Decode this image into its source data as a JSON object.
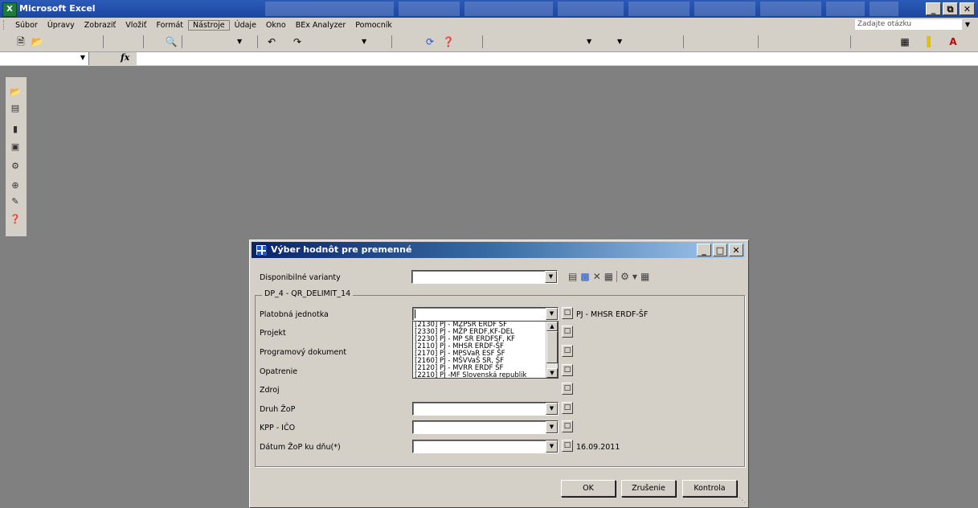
{
  "window": {
    "title": "Microsoft Excel"
  },
  "menu": {
    "items": [
      "Súbor",
      "Úpravy",
      "Zobraziť",
      "Vložiť",
      "Formát",
      "Nástroje",
      "Údaje",
      "Okno",
      "BEx Analyzer",
      "Pomocník"
    ],
    "help_placeholder": "Zadajte otázku"
  },
  "formula": {
    "fx": "fx"
  },
  "dialog": {
    "title": "Výber hodnôt pre premenné",
    "variants_label": "Disponibilné varianty",
    "group_title": "DP_4 - QR_DELIMIT_14",
    "fields": [
      {
        "label": "Platobná jednotka",
        "value": "PJ - MHSR  ERDF-ŠF"
      },
      {
        "label": "Projekt",
        "value": ""
      },
      {
        "label": "Programový dokument",
        "value": ""
      },
      {
        "label": "Opatrenie",
        "value": ""
      },
      {
        "label": "Zdroj",
        "value": ""
      },
      {
        "label": "Druh ŽoP",
        "value": ""
      },
      {
        "label": "KPP - IČO",
        "value": ""
      },
      {
        "label": "Dátum ŽoP ku dňu(*)",
        "value": "16.09.2011"
      }
    ],
    "dropdown_options": [
      "[2130] PJ - MŽPSR  ERDF ŠF",
      "[2330] PJ - MŽP  ERDF,KF-DEL",
      "[2230] PJ - MP SR ERDFSF, KF",
      "[2110] PJ  - MHSR  ERDF-ŠF",
      "[2170] PJ - MPSVaR ESF ŠF",
      "[2160] PJ - MŠVVaŠ SR, ŠF",
      "[2120] PJ - MVRR  ERDF ŠF",
      "[2210] PJ -MF Slovenská republik"
    ],
    "buttons": {
      "ok": "OK",
      "cancel": "Zrušenie",
      "check": "Kontrola"
    }
  }
}
